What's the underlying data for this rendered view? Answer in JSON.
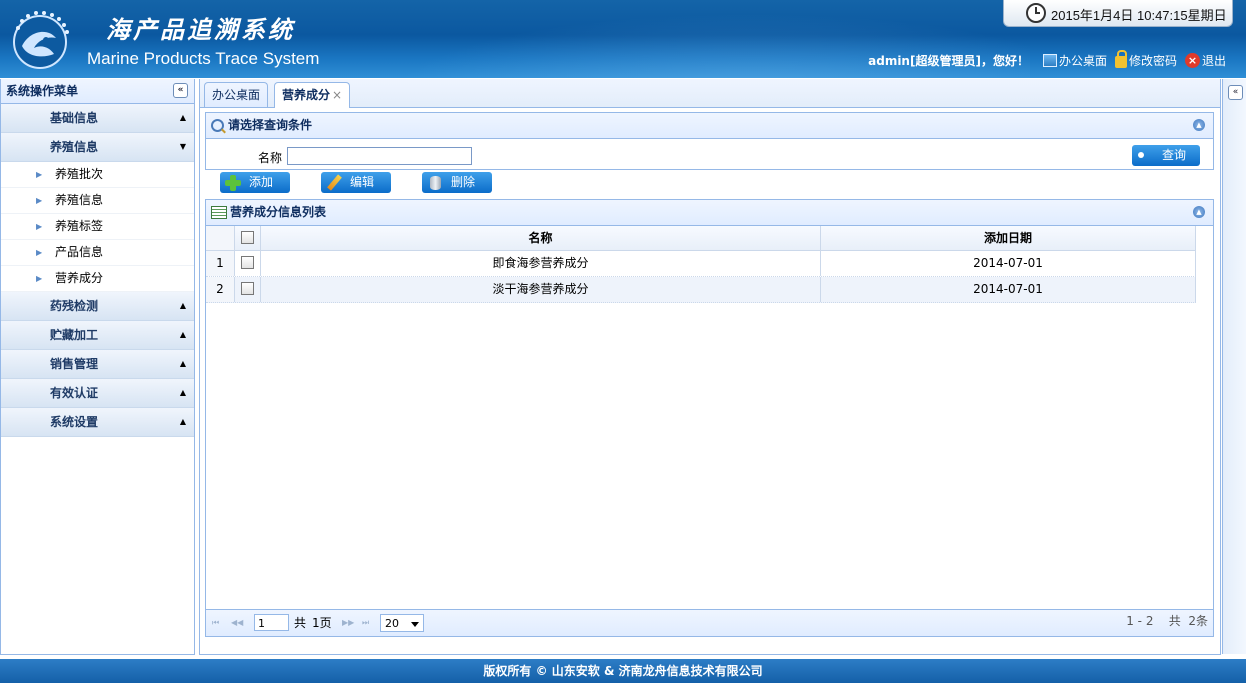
{
  "app": {
    "title_cn": "海产品追溯系统",
    "title_en": "Marine Products Trace System",
    "datetime": "2015年1月4日  10:47:15星期日"
  },
  "userbar": {
    "welcome": "admin[超级管理员]，您好！",
    "desktop_link": "办公桌面",
    "password_link": "修改密码",
    "logout_link": "退出"
  },
  "sidebar": {
    "title": "系统操作菜单",
    "collapse": "«",
    "groups": [
      {
        "label": "基础信息"
      },
      {
        "label": "养殖信息",
        "items": [
          "养殖批次",
          "养殖信息",
          "养殖标签",
          "产品信息",
          "营养成分"
        ]
      },
      {
        "label": "药残检测"
      },
      {
        "label": "贮藏加工"
      },
      {
        "label": "销售管理"
      },
      {
        "label": "有效认证"
      },
      {
        "label": "系统设置"
      }
    ]
  },
  "tabs": [
    {
      "label": "办公桌面"
    },
    {
      "label": "营养成分",
      "close": "×"
    }
  ],
  "query": {
    "title": "请选择查询条件",
    "name_label": "名称",
    "name_value": "",
    "search_button": "查询"
  },
  "toolbar": {
    "add": "添加",
    "edit": "编辑",
    "delete": "删除"
  },
  "grid": {
    "title": "营养成分信息列表",
    "columns": [
      "名称",
      "添加日期"
    ],
    "rows": [
      {
        "no": "1",
        "name": "即食海参营养成分",
        "date": "2014-07-01"
      },
      {
        "no": "2",
        "name": "淡干海参营养成分",
        "date": "2014-07-01"
      }
    ]
  },
  "pager": {
    "page": "1",
    "total_pages_prefix": "共",
    "total_pages": "1页",
    "page_size": "20",
    "summary": "1 - 2    共  2条"
  },
  "footer": "版权所有  © 山东安软  & 济南龙舟信息技术有限公司"
}
